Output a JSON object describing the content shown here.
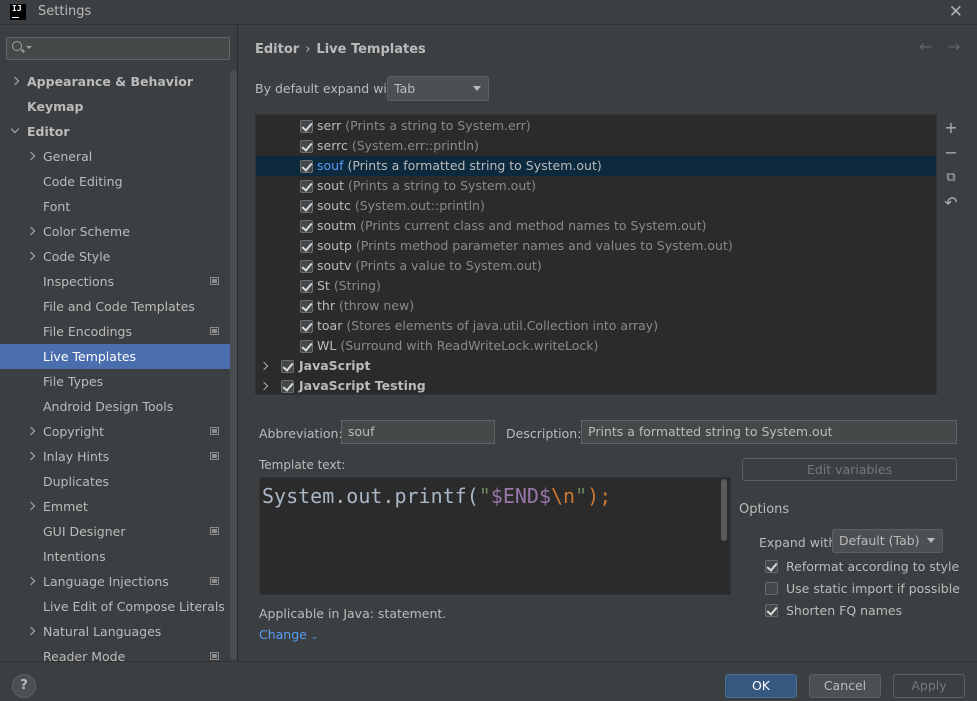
{
  "window": {
    "title": "Settings",
    "logo_text": "IJ"
  },
  "search": {
    "placeholder": ""
  },
  "sidebar": {
    "items": [
      {
        "label": "Appearance & Behavior",
        "bold": true,
        "chevron": "right",
        "indent": 0
      },
      {
        "label": "Keymap",
        "bold": true,
        "chevron": "",
        "indent": 0
      },
      {
        "label": "Editor",
        "bold": true,
        "chevron": "down",
        "indent": 0
      },
      {
        "label": "General",
        "chevron": "right",
        "indent": 1
      },
      {
        "label": "Code Editing",
        "chevron": "",
        "indent": 1
      },
      {
        "label": "Font",
        "chevron": "",
        "indent": 1
      },
      {
        "label": "Color Scheme",
        "chevron": "right",
        "indent": 1
      },
      {
        "label": "Code Style",
        "chevron": "right",
        "indent": 1
      },
      {
        "label": "Inspections",
        "chevron": "",
        "indent": 1,
        "project_icon": true
      },
      {
        "label": "File and Code Templates",
        "chevron": "",
        "indent": 1
      },
      {
        "label": "File Encodings",
        "chevron": "",
        "indent": 1,
        "project_icon": true
      },
      {
        "label": "Live Templates",
        "chevron": "",
        "indent": 1,
        "selected": true
      },
      {
        "label": "File Types",
        "chevron": "",
        "indent": 1
      },
      {
        "label": "Android Design Tools",
        "chevron": "",
        "indent": 1
      },
      {
        "label": "Copyright",
        "chevron": "right",
        "indent": 1,
        "project_icon": true
      },
      {
        "label": "Inlay Hints",
        "chevron": "right",
        "indent": 1,
        "project_icon": true
      },
      {
        "label": "Duplicates",
        "chevron": "",
        "indent": 1
      },
      {
        "label": "Emmet",
        "chevron": "right",
        "indent": 1
      },
      {
        "label": "GUI Designer",
        "chevron": "",
        "indent": 1,
        "project_icon": true
      },
      {
        "label": "Intentions",
        "chevron": "",
        "indent": 1
      },
      {
        "label": "Language Injections",
        "chevron": "right",
        "indent": 1,
        "project_icon": true
      },
      {
        "label": "Live Edit of Compose Literals",
        "chevron": "",
        "indent": 1
      },
      {
        "label": "Natural Languages",
        "chevron": "right",
        "indent": 1
      },
      {
        "label": "Reader Mode",
        "chevron": "",
        "indent": 1,
        "project_icon": true
      }
    ]
  },
  "breadcrumb": {
    "parent": "Editor",
    "separator": "›",
    "current": "Live Templates"
  },
  "nav": {
    "back": "←",
    "forward": "→"
  },
  "expand": {
    "label": "By default expand with",
    "value": "Tab"
  },
  "templates": [
    {
      "abbr": "serr",
      "desc": "(Prints a string to System.err)",
      "checked": true
    },
    {
      "abbr": "serrc",
      "desc": "(System.err::println)",
      "checked": true
    },
    {
      "abbr": "souf",
      "desc": "(Prints a formatted string to System.out)",
      "checked": true,
      "selected": true
    },
    {
      "abbr": "sout",
      "desc": "(Prints a string to System.out)",
      "checked": true
    },
    {
      "abbr": "soutc",
      "desc": "(System.out::println)",
      "checked": true
    },
    {
      "abbr": "soutm",
      "desc": "(Prints current class and method names to System.out)",
      "checked": true
    },
    {
      "abbr": "soutp",
      "desc": "(Prints method parameter names and values to System.out)",
      "checked": true
    },
    {
      "abbr": "soutv",
      "desc": "(Prints a value to System.out)",
      "checked": true
    },
    {
      "abbr": "St",
      "desc": "(String)",
      "checked": true
    },
    {
      "abbr": "thr",
      "desc": "(throw new)",
      "checked": true
    },
    {
      "abbr": "toar",
      "desc": "(Stores elements of java.util.Collection into array)",
      "checked": true
    },
    {
      "abbr": "WL",
      "desc": "(Surround with ReadWriteLock.writeLock)",
      "checked": true
    },
    {
      "group": "JavaScript",
      "checked": true
    },
    {
      "group": "JavaScript Testing",
      "checked": true
    }
  ],
  "toolbar": {
    "add": "+",
    "remove": "−",
    "copy": "⧉",
    "revert": "↶"
  },
  "abbreviation": {
    "label": "Abbreviation:",
    "value": "souf"
  },
  "description": {
    "label": "Description:",
    "value": "Prints a formatted string to System.out"
  },
  "template_text": {
    "label": "Template text:",
    "code_prefix": "System.out.printf(",
    "code_quote_open": "\"",
    "code_variable": "$END$",
    "code_escape": "\\n",
    "code_quote_close": "\"",
    "code_suffix": ");"
  },
  "edit_variables": "Edit variables",
  "options": {
    "title": "Options",
    "expand_label": "Expand with",
    "expand_value": "Default (Tab)",
    "reformat": {
      "label": "Reformat according to style",
      "checked": true
    },
    "static_import": {
      "label": "Use static import if possible",
      "checked": false
    },
    "shorten_fq": {
      "label": "Shorten FQ names",
      "checked": true
    }
  },
  "applicable": {
    "text": "Applicable in Java: statement.",
    "change": "Change"
  },
  "footer": {
    "help": "?",
    "ok": "OK",
    "cancel": "Cancel",
    "apply": "Apply"
  },
  "colors": {
    "selection": "#4b6eaf",
    "list_selection": "#0d293e",
    "link": "#589df6",
    "code_string": "#6a8759",
    "code_variable": "#9876aa",
    "code_escape": "#cc7832"
  }
}
